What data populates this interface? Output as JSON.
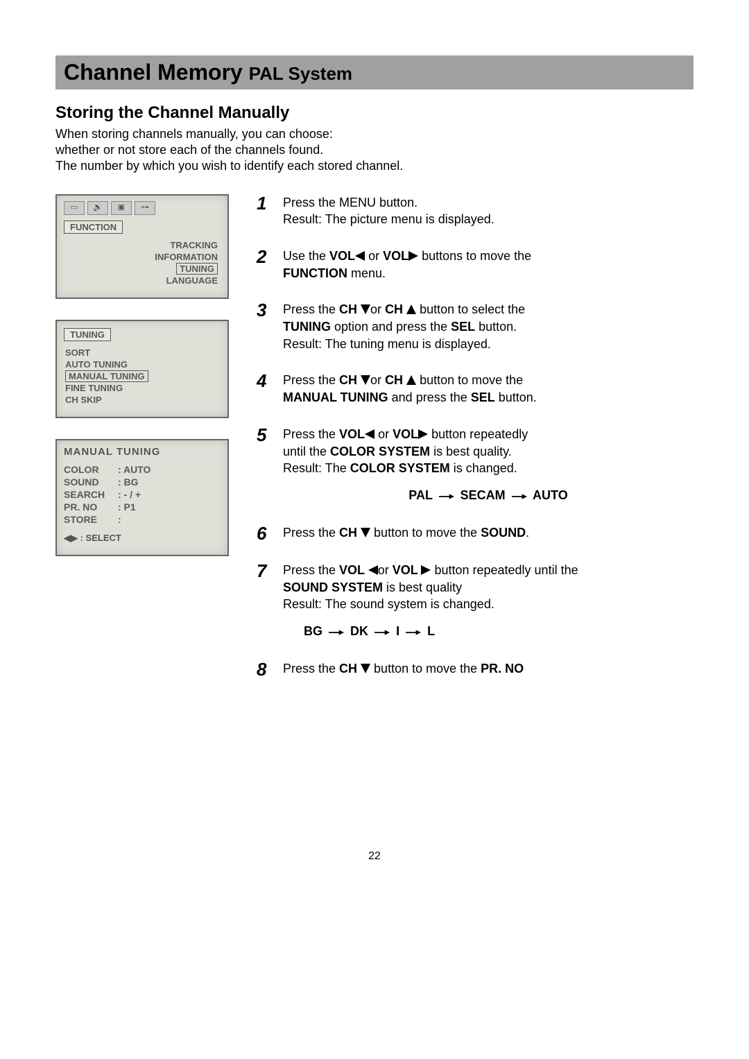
{
  "titlebar": {
    "main": "Channel Memory ",
    "sub": "PAL System"
  },
  "section_heading": "Storing the Channel Manually",
  "intro": {
    "line1": "When storing channels manually, you can choose:",
    "line2": "whether or not store each of the channels found.",
    "line3": "The number by which you wish to identify each stored channel."
  },
  "shots": {
    "function_menu": {
      "title": "FUNCTION",
      "items": [
        "TRACKING",
        "INFORMATION",
        "TUNING",
        "LANGUAGE"
      ],
      "highlighted": "TUNING"
    },
    "tuning_menu": {
      "title": "TUNING",
      "items": [
        "SORT",
        "AUTO TUNING",
        "MANUAL TUNING",
        "FINE TUNING",
        "CH SKIP"
      ],
      "highlighted": "MANUAL TUNING"
    },
    "manual_tuning": {
      "title": "MANUAL  TUNING",
      "rows": [
        {
          "k": "COLOR",
          "v": ": AUTO"
        },
        {
          "k": "SOUND",
          "v": ": BG"
        },
        {
          "k": "SEARCH",
          "v": ": - / +"
        },
        {
          "k": "PR. NO",
          "v": ": P1"
        },
        {
          "k": "STORE",
          "v": ":"
        }
      ],
      "footer_icons": "◀▶",
      "footer_label": " : SELECT"
    }
  },
  "steps": {
    "s1": {
      "num": "1",
      "a": "Press the MENU button.",
      "b": "Result: The picture menu is displayed."
    },
    "s2": {
      "num": "2",
      "a1": "Use the ",
      "vol_l": "VOL",
      "or": " or ",
      "vol_r": "VOL",
      "a2": " buttons to move the",
      "b1": "FUNCTION",
      "b2": " menu."
    },
    "s3": {
      "num": "3",
      "a1": "Press the ",
      "ch": "CH ",
      "or": "or ",
      "a2": " button to select the",
      "b1": "TUNING",
      "b2": " option and press the ",
      "sel": "SEL",
      "b3": " button.",
      "c": "Result: The tuning menu is displayed."
    },
    "s4": {
      "num": "4",
      "a1": "Press the ",
      "ch": "CH ",
      "or": "or ",
      "a2": " button to move the",
      "b1": "MANUAL TUNING",
      "b2": " and press the ",
      "sel": "SEL",
      "b3": " button."
    },
    "s5": {
      "num": "5",
      "a1": "Press the ",
      "vol": "VOL",
      "or": " or ",
      "a2": " button repeatedly",
      "b1": "until the ",
      "cs": "COLOR SYSTEM",
      "b2": " is best quality.",
      "c1": "Result: The ",
      "c2": " is changed.",
      "seq": [
        "PAL",
        "SECAM",
        "AUTO"
      ]
    },
    "s6": {
      "num": "6",
      "a1": "Press the ",
      "ch": "CH ",
      "a2": " button to move the ",
      "snd": "SOUND",
      "a3": "."
    },
    "s7": {
      "num": "7",
      "a1": "Press the ",
      "vol": "VOL ",
      "or": "or ",
      "a2": " button repeatedly until the",
      "b1": "SOUND SYSTEM",
      "b2": " is best quality",
      "c": "Result: The sound system is changed.",
      "seq": [
        "BG",
        "DK",
        "I",
        "L"
      ]
    },
    "s8": {
      "num": "8",
      "a1": "Press the ",
      "ch": "CH ",
      "a2": " button to move the ",
      "pr": "PR. NO"
    }
  },
  "page_number": "22"
}
